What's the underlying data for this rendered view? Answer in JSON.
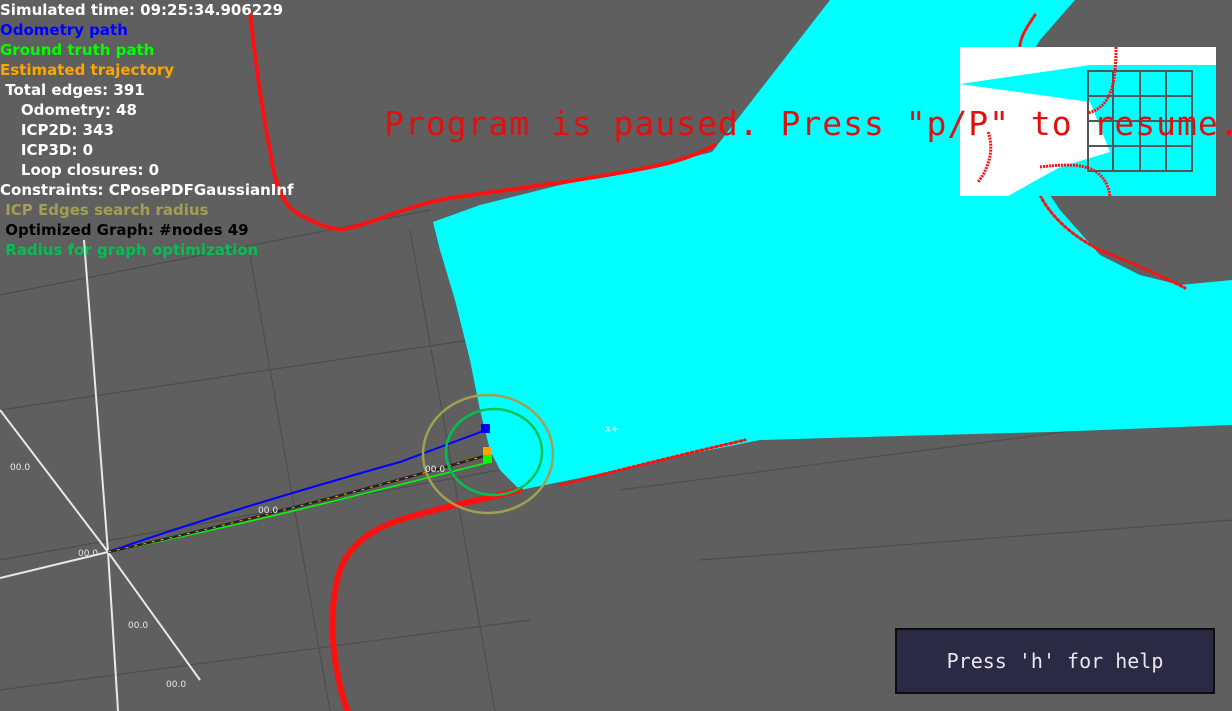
{
  "overlay": {
    "simulated_time": "Simulated time: 09:25:34.906229",
    "odometry_path": "Odometry path",
    "ground_truth_path": "Ground truth path",
    "estimated_trajectory": "Estimated trajectory",
    "total_edges": " Total edges: 391",
    "odometry_edges": "    Odometry: 48",
    "icp2d_edges": "    ICP2D: 343",
    "icp3d_edges": "    ICP3D: 0",
    "loop_closures": "    Loop closures: 0",
    "constraints": "Constraints: CPosePDFGaussianInf",
    "icp_radius": " ICP Edges search radius",
    "optimized_graph": " Optimized Graph: #nodes 49",
    "optimization_radius": " Radius for graph optimization"
  },
  "paused_message": "Program is paused. Press \"p/P\" to resume.",
  "help_button": "Press 'h' for help",
  "axis_labels": {
    "left_a": "00.0",
    "left_b": "00.0",
    "mid_a": "00.0",
    "mid_b": "00.0",
    "bottom_a": "00.0",
    "bottom_b": "00.0"
  },
  "colors": {
    "background": "#5f5f5f",
    "free_space": "#00ffff",
    "laser_points": "#ff1010",
    "odometry": "#0000ff",
    "ground_truth": "#00ff00",
    "estimated": "#ffa500",
    "icp_radius": "#a0a050",
    "optimization_radius": "#00c050",
    "paused_text": "#e01010",
    "help_bg": "#2a2a45"
  }
}
